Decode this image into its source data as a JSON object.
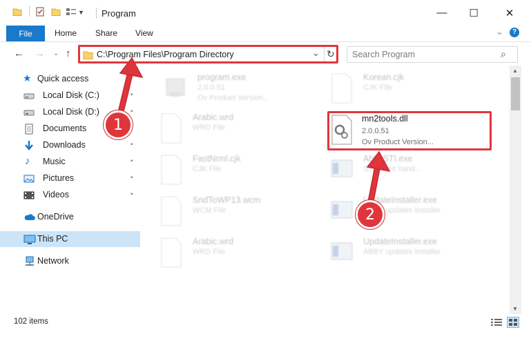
{
  "window": {
    "title": "Program",
    "minimize_glyph": "—",
    "maximize_glyph": "☐",
    "close_glyph": "✕"
  },
  "ribbon": {
    "file": "File",
    "home": "Home",
    "share": "Share",
    "view": "View",
    "collapse_glyph": "⌄",
    "help_glyph": "?"
  },
  "address": {
    "path": "C:\\Program Files\\Program Directory",
    "back": "←",
    "forward": "→",
    "dropdown": "⌄",
    "up": "↑",
    "refresh": "↻"
  },
  "search": {
    "placeholder": "Search Program",
    "icon": "⌕"
  },
  "sidebar": {
    "items": [
      {
        "label": "Quick access",
        "icon": "star-icon",
        "pinned": false
      },
      {
        "label": "Local Disk (C:)",
        "icon": "drive-icon",
        "pinned": true
      },
      {
        "label": "Local Disk (D:)",
        "icon": "drive-icon",
        "pinned": true
      },
      {
        "label": "Documents",
        "icon": "documents-icon",
        "pinned": true
      },
      {
        "label": "Downloads",
        "icon": "download-icon",
        "pinned": true
      },
      {
        "label": "Music",
        "icon": "music-icon",
        "pinned": true
      },
      {
        "label": "Pictures",
        "icon": "pictures-icon",
        "pinned": true
      },
      {
        "label": "Videos",
        "icon": "videos-icon",
        "pinned": true
      },
      {
        "label": "OneDrive",
        "icon": "cloud-icon",
        "pinned": false
      },
      {
        "label": "This PC",
        "icon": "computer-icon",
        "pinned": false,
        "selected": true
      },
      {
        "label": "Network",
        "icon": "network-icon",
        "pinned": false
      }
    ],
    "pin_glyph": "📌"
  },
  "files": {
    "program_exe": {
      "name": "program.exe",
      "line1": "2.0.0.51",
      "line2": "Ov  Product Version..."
    },
    "korean_cjk": {
      "name": "Korean.cjk",
      "line1": "CJK File"
    },
    "arabic_wrd_1": {
      "name": "Arabic.wrd",
      "line1": "WRD File"
    },
    "mn2tools_dll": {
      "name": "mn2tools.dll",
      "line1": "2.0.0.51",
      "line2": "Ov  Product Version..."
    },
    "fastnrml_cjk": {
      "name": "FastNrml.cjk",
      "line1": "CJK File"
    },
    "abbysti_exe": {
      "name": "AbbySTI.exe",
      "line1": "STI event hand..."
    },
    "sndtowp13_wcm": {
      "name": "SndToWP13.wcm",
      "line1": "WCM File"
    },
    "updateinstaller_1": {
      "name": "UpdateInstaller.exe",
      "line1": "ABBY updates installer"
    },
    "arabic_wrd_2": {
      "name": "Arabic.wrd",
      "line1": "WRD File"
    },
    "updateinstaller_2": {
      "name": "UpdateInstaller.exe",
      "line1": "ABBY updates installer"
    }
  },
  "status": {
    "items_count": "102 items"
  },
  "steps": {
    "one": "1",
    "two": "2"
  },
  "colors": {
    "accent": "#1979ca",
    "highlight_red": "#e0353c",
    "selected_nav": "#cce4f7"
  }
}
